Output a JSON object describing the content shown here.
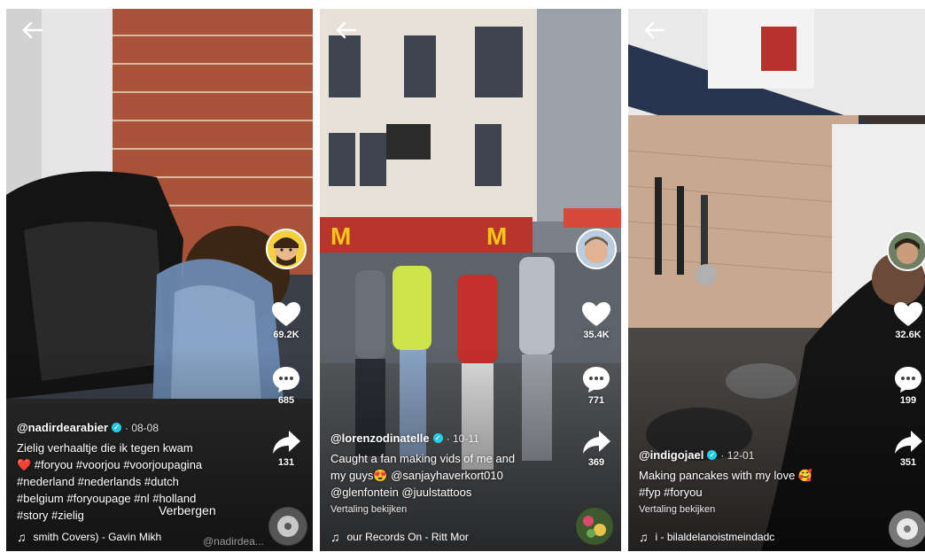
{
  "colors": {
    "like": "#ffffff",
    "verified": "#20d5ec",
    "hashtag_heart": "#e8264a"
  },
  "videos": [
    {
      "username": "@nadirdearabier",
      "date": "· 08-08",
      "caption_lines": [
        "Zielig verhaaltje die ik tegen kwam",
        "❤️ #foryou #voorjou #voorjoupagina",
        "#nederland #nederlands #dutch",
        "#belgium #foryoupage #nl #holland",
        "#story #zielig"
      ],
      "likes": "69.2K",
      "comments": "685",
      "shares": "131",
      "music": "smith Covers) - Gavin Mikh",
      "hide_label": "Verbergen",
      "watermark": "@nadirdea..."
    },
    {
      "username": "@lorenzodinatelle",
      "date": "· 10-11",
      "caption_lines": [
        "Caught a fan making vids of me and",
        "my guys😍 @sanjayhaverkort010",
        "@glenfontein @juulstattoos"
      ],
      "translate": "Vertaling bekijken",
      "likes": "35.4K",
      "comments": "771",
      "shares": "369",
      "music": "our Records On - Ritt Mor"
    },
    {
      "username": "@indigojael",
      "date": "· 12-01",
      "caption_lines": [
        "Making pancakes with my love 🥰",
        "#fyp #foryou"
      ],
      "translate": "Vertaling bekijken",
      "likes": "32.6K",
      "comments": "199",
      "shares": "351",
      "music": "i - bilaldelanoistmeindadc"
    }
  ]
}
